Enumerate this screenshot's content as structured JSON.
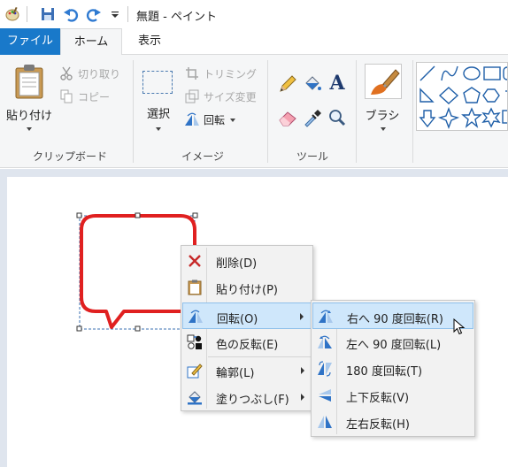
{
  "window": {
    "title": "無題 - ペイント",
    "quick_access": [
      "save-icon",
      "undo-icon",
      "redo-icon",
      "customize-dropdown-icon"
    ]
  },
  "tabs": [
    {
      "label": "ファイル",
      "active": false
    },
    {
      "label": "ホーム",
      "active": true
    },
    {
      "label": "表示",
      "active": false
    }
  ],
  "ribbon": {
    "clipboard": {
      "group_label": "クリップボード",
      "paste_label": "貼り付け",
      "cut_label": "切り取り",
      "copy_label": "コピー"
    },
    "image": {
      "group_label": "イメージ",
      "select_label": "選択",
      "crop_label": "トリミング",
      "resize_label": "サイズ変更",
      "rotate_label": "回転"
    },
    "tools": {
      "group_label": "ツール",
      "items": [
        "pencil-icon",
        "fill-icon",
        "text-icon",
        "eraser-icon",
        "color-picker-icon",
        "magnifier-icon"
      ]
    },
    "brush": {
      "label": "ブラシ"
    },
    "shapes": {
      "items": [
        "line-shape",
        "curve-shape",
        "oval-shape",
        "rectangle-shape",
        "rounded-rect-shape",
        "polygon-shape",
        "triangle-shape",
        "right-triangle-shape",
        "diamond-shape",
        "pentagon-shape",
        "hexagon-shape",
        "arrow-right-shape",
        "arrow-down-shape",
        "star4-shape",
        "star5-shape",
        "star6-shape",
        "callout-shape"
      ]
    }
  },
  "context_menu": {
    "items": [
      {
        "label": "削除(D)",
        "icon": "delete-icon",
        "submenu": false
      },
      {
        "label": "貼り付け(P)",
        "icon": "paste-icon",
        "submenu": false
      },
      {
        "label": "回転(O)",
        "icon": "rotate-icon",
        "submenu": true,
        "highlighted": true
      },
      {
        "label": "色の反転(E)",
        "icon": "invert-color-icon",
        "submenu": false
      },
      {
        "label": "輪郭(L)",
        "icon": "outline-icon",
        "submenu": true
      },
      {
        "label": "塗りつぶし(F)",
        "icon": "fill-icon",
        "submenu": true
      }
    ]
  },
  "rotate_submenu": {
    "items": [
      {
        "label": "右へ 90 度回転(R)",
        "icon": "rotate-right-icon",
        "highlighted": true
      },
      {
        "label": "左へ 90 度回転(L)",
        "icon": "rotate-left-icon"
      },
      {
        "label": "180 度回転(T)",
        "icon": "rotate-180-icon"
      },
      {
        "label": "上下反転(V)",
        "icon": "flip-vertical-icon"
      },
      {
        "label": "左右反転(H)",
        "icon": "flip-horizontal-icon"
      }
    ]
  },
  "colors": {
    "file_tab": "#1979ca",
    "callout_stroke": "#e02020",
    "menu_highlight": "#cfe7fb"
  }
}
